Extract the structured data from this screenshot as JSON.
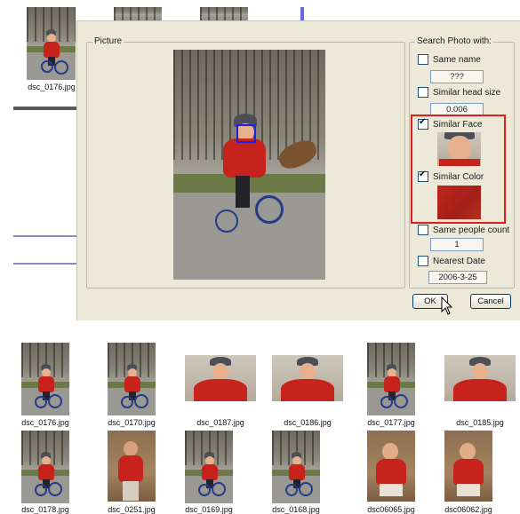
{
  "top_thumbs": {
    "caption": "dsc_0176.jpg"
  },
  "dialog": {
    "picture_group_title": "Picture",
    "search_group_title": "Search Photo with:",
    "options": [
      {
        "label": "Same name",
        "checked": false,
        "value": "???"
      },
      {
        "label": "Similar head size",
        "checked": false,
        "value": "0.006"
      },
      {
        "label": "Similar Face",
        "checked": true
      },
      {
        "label": "Similar Color",
        "checked": true
      },
      {
        "label": "Same people count",
        "checked": false,
        "value": "1"
      },
      {
        "label": "Nearest Date",
        "checked": false,
        "value": "2006-3-25"
      }
    ],
    "ok_label": "OK",
    "cancel_label": "Cancel",
    "highlight_color": "#e11c1c",
    "face_box_color": "#2020e0"
  },
  "results": [
    {
      "caption": "dsc_0176.jpg",
      "scene": "outdoor-tricycle"
    },
    {
      "caption": "dsc_0170.jpg",
      "scene": "outdoor-tricycle"
    },
    {
      "caption": "dsc_0187.jpg",
      "scene": "face-closeup"
    },
    {
      "caption": "dsc_0186.jpg",
      "scene": "face-closeup"
    },
    {
      "caption": "dsc_0177.jpg",
      "scene": "outdoor-tricycle"
    },
    {
      "caption": "dsc_0185.jpg",
      "scene": "face-closeup"
    },
    {
      "caption": "dsc_0178.jpg",
      "scene": "outdoor-tricycle"
    },
    {
      "caption": "dsc_0251.jpg",
      "scene": "indoor-standing"
    },
    {
      "caption": "dsc_0169.jpg",
      "scene": "outdoor-tricycle"
    },
    {
      "caption": "dsc_0168.jpg",
      "scene": "outdoor-tricycle"
    },
    {
      "caption": "dsc06065.jpg",
      "scene": "indoor-sitting"
    },
    {
      "caption": "dsc06062.jpg",
      "scene": "indoor-sitting"
    }
  ]
}
